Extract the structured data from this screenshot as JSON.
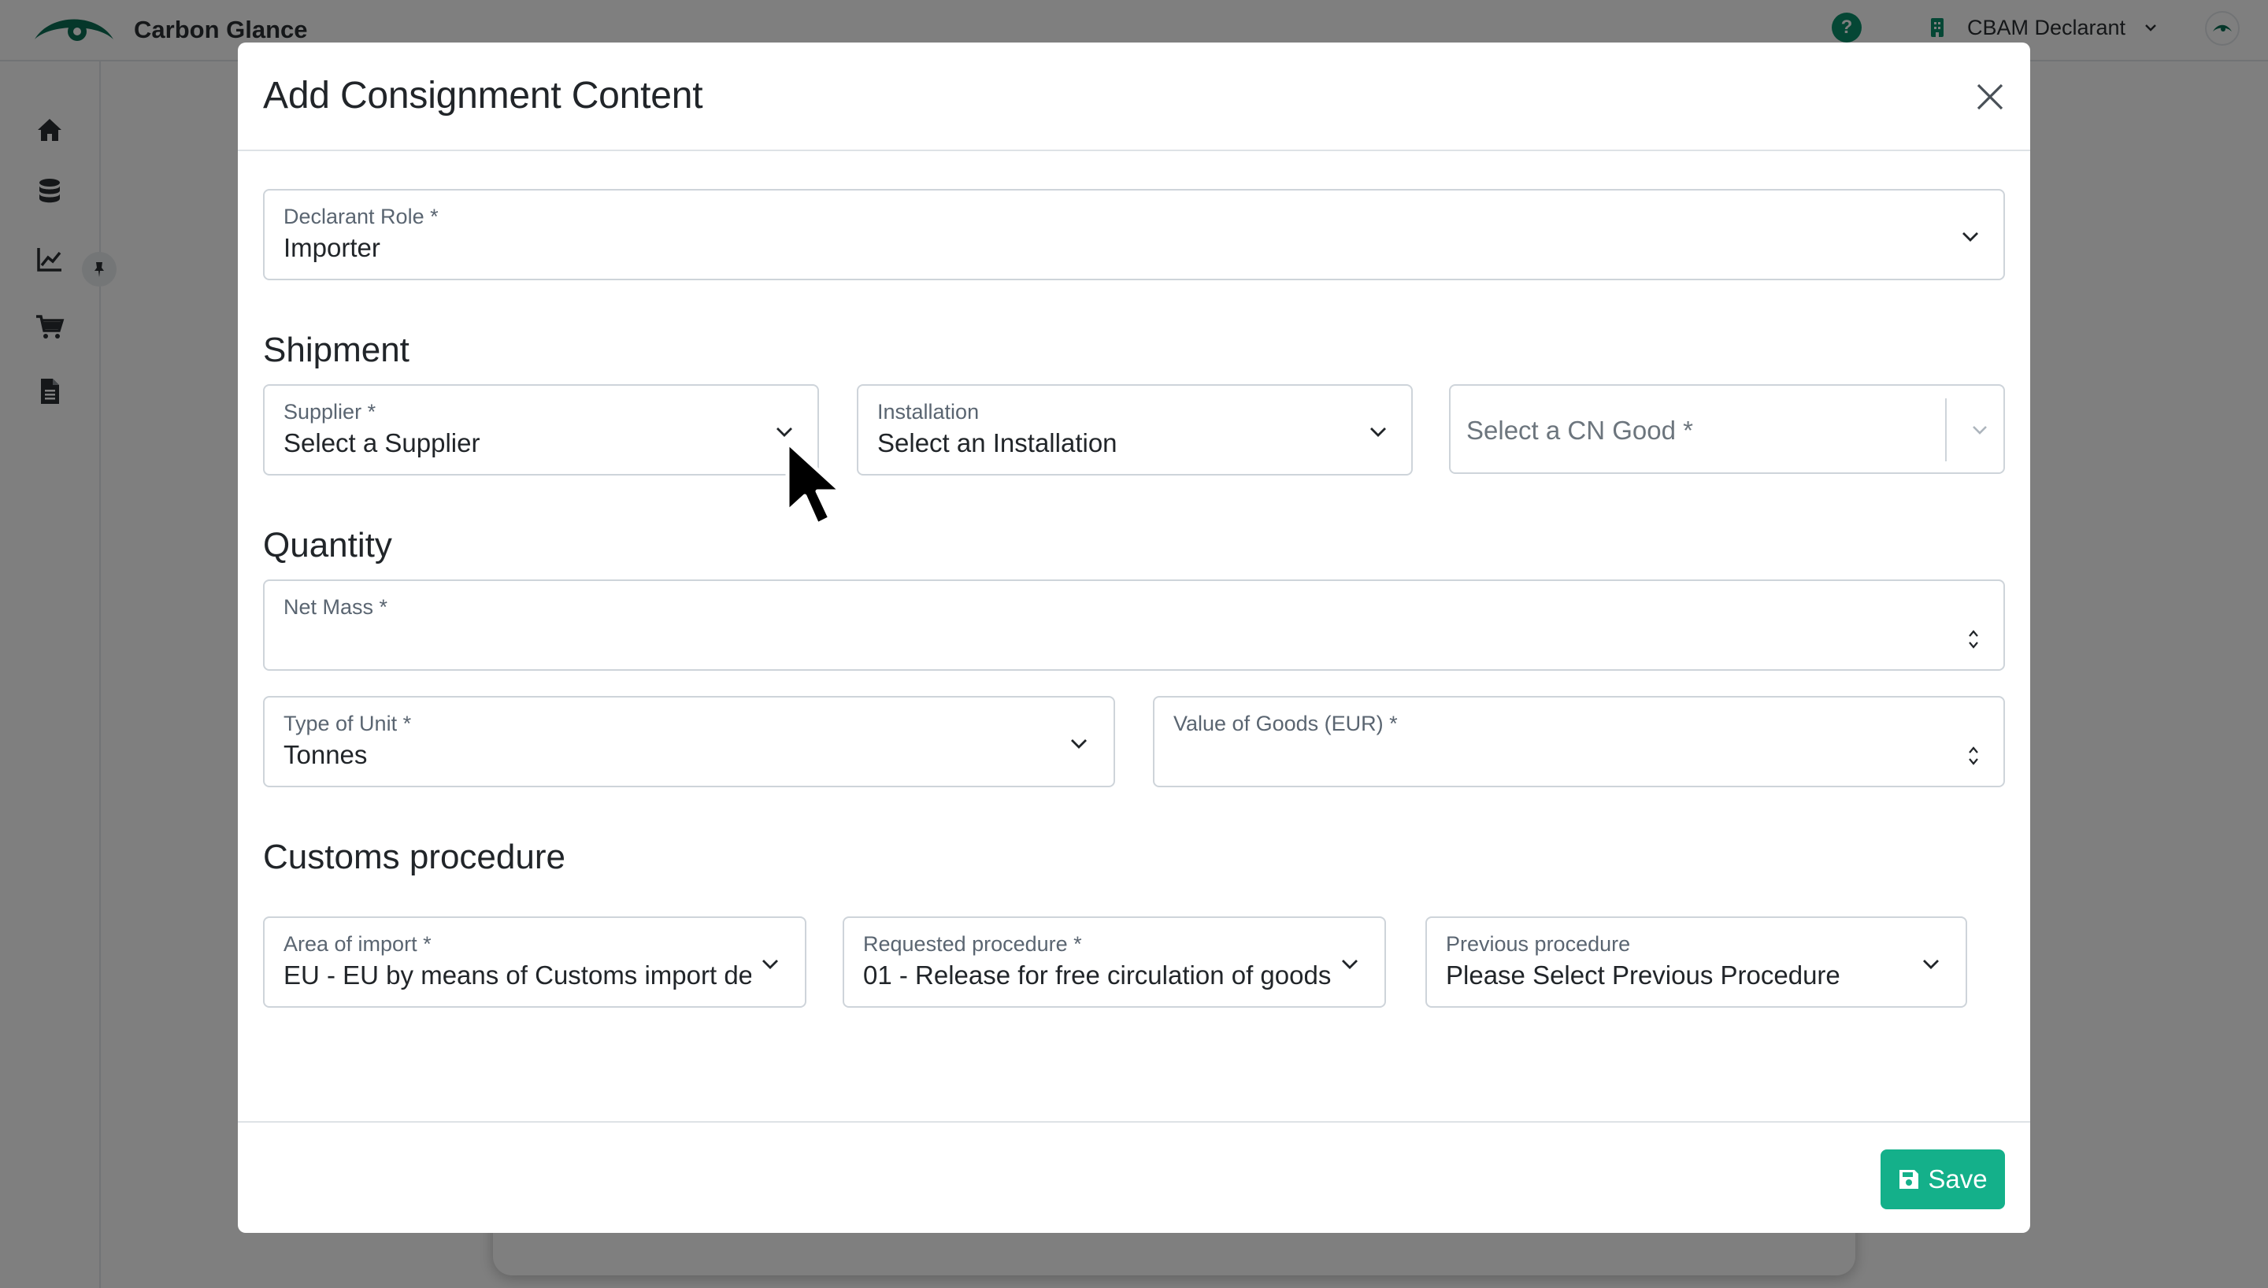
{
  "app": {
    "brand_name": "Carbon Glance",
    "role_menu_label": "CBAM Declarant",
    "help_glyph": "?",
    "brand_color": "#0b6e55",
    "sidebar_icons": [
      "home-icon",
      "database-icon",
      "chart-line-icon",
      "shopping-cart-icon",
      "document-icon"
    ]
  },
  "modal": {
    "title": "Add Consignment Content",
    "declarant_role": {
      "label": "Declarant Role *",
      "value": "Importer"
    },
    "shipment": {
      "title": "Shipment",
      "supplier": {
        "label": "Supplier *",
        "value": "Select a Supplier"
      },
      "installation": {
        "label": "Installation",
        "value": "Select an Installation"
      },
      "cn_good": {
        "placeholder": "Select a CN Good *"
      }
    },
    "quantity": {
      "title": "Quantity",
      "net_mass": {
        "label": "Net Mass *",
        "value": ""
      },
      "type_of_unit": {
        "label": "Type of Unit *",
        "value": "Tonnes"
      },
      "value_of_goods": {
        "label": "Value of Goods (EUR) *",
        "value": ""
      }
    },
    "customs": {
      "title": "Customs procedure",
      "area_of_import": {
        "label": "Area of import *",
        "value": "EU - EU by means of Customs import declaration"
      },
      "requested_procedure": {
        "label": "Requested procedure *",
        "value": "01 - Release for free circulation of goods"
      },
      "previous_procedure": {
        "label": "Previous procedure",
        "value": "Please Select Previous Procedure"
      }
    },
    "footer": {
      "save_label": "Save",
      "save_color": "#14b08a"
    }
  }
}
